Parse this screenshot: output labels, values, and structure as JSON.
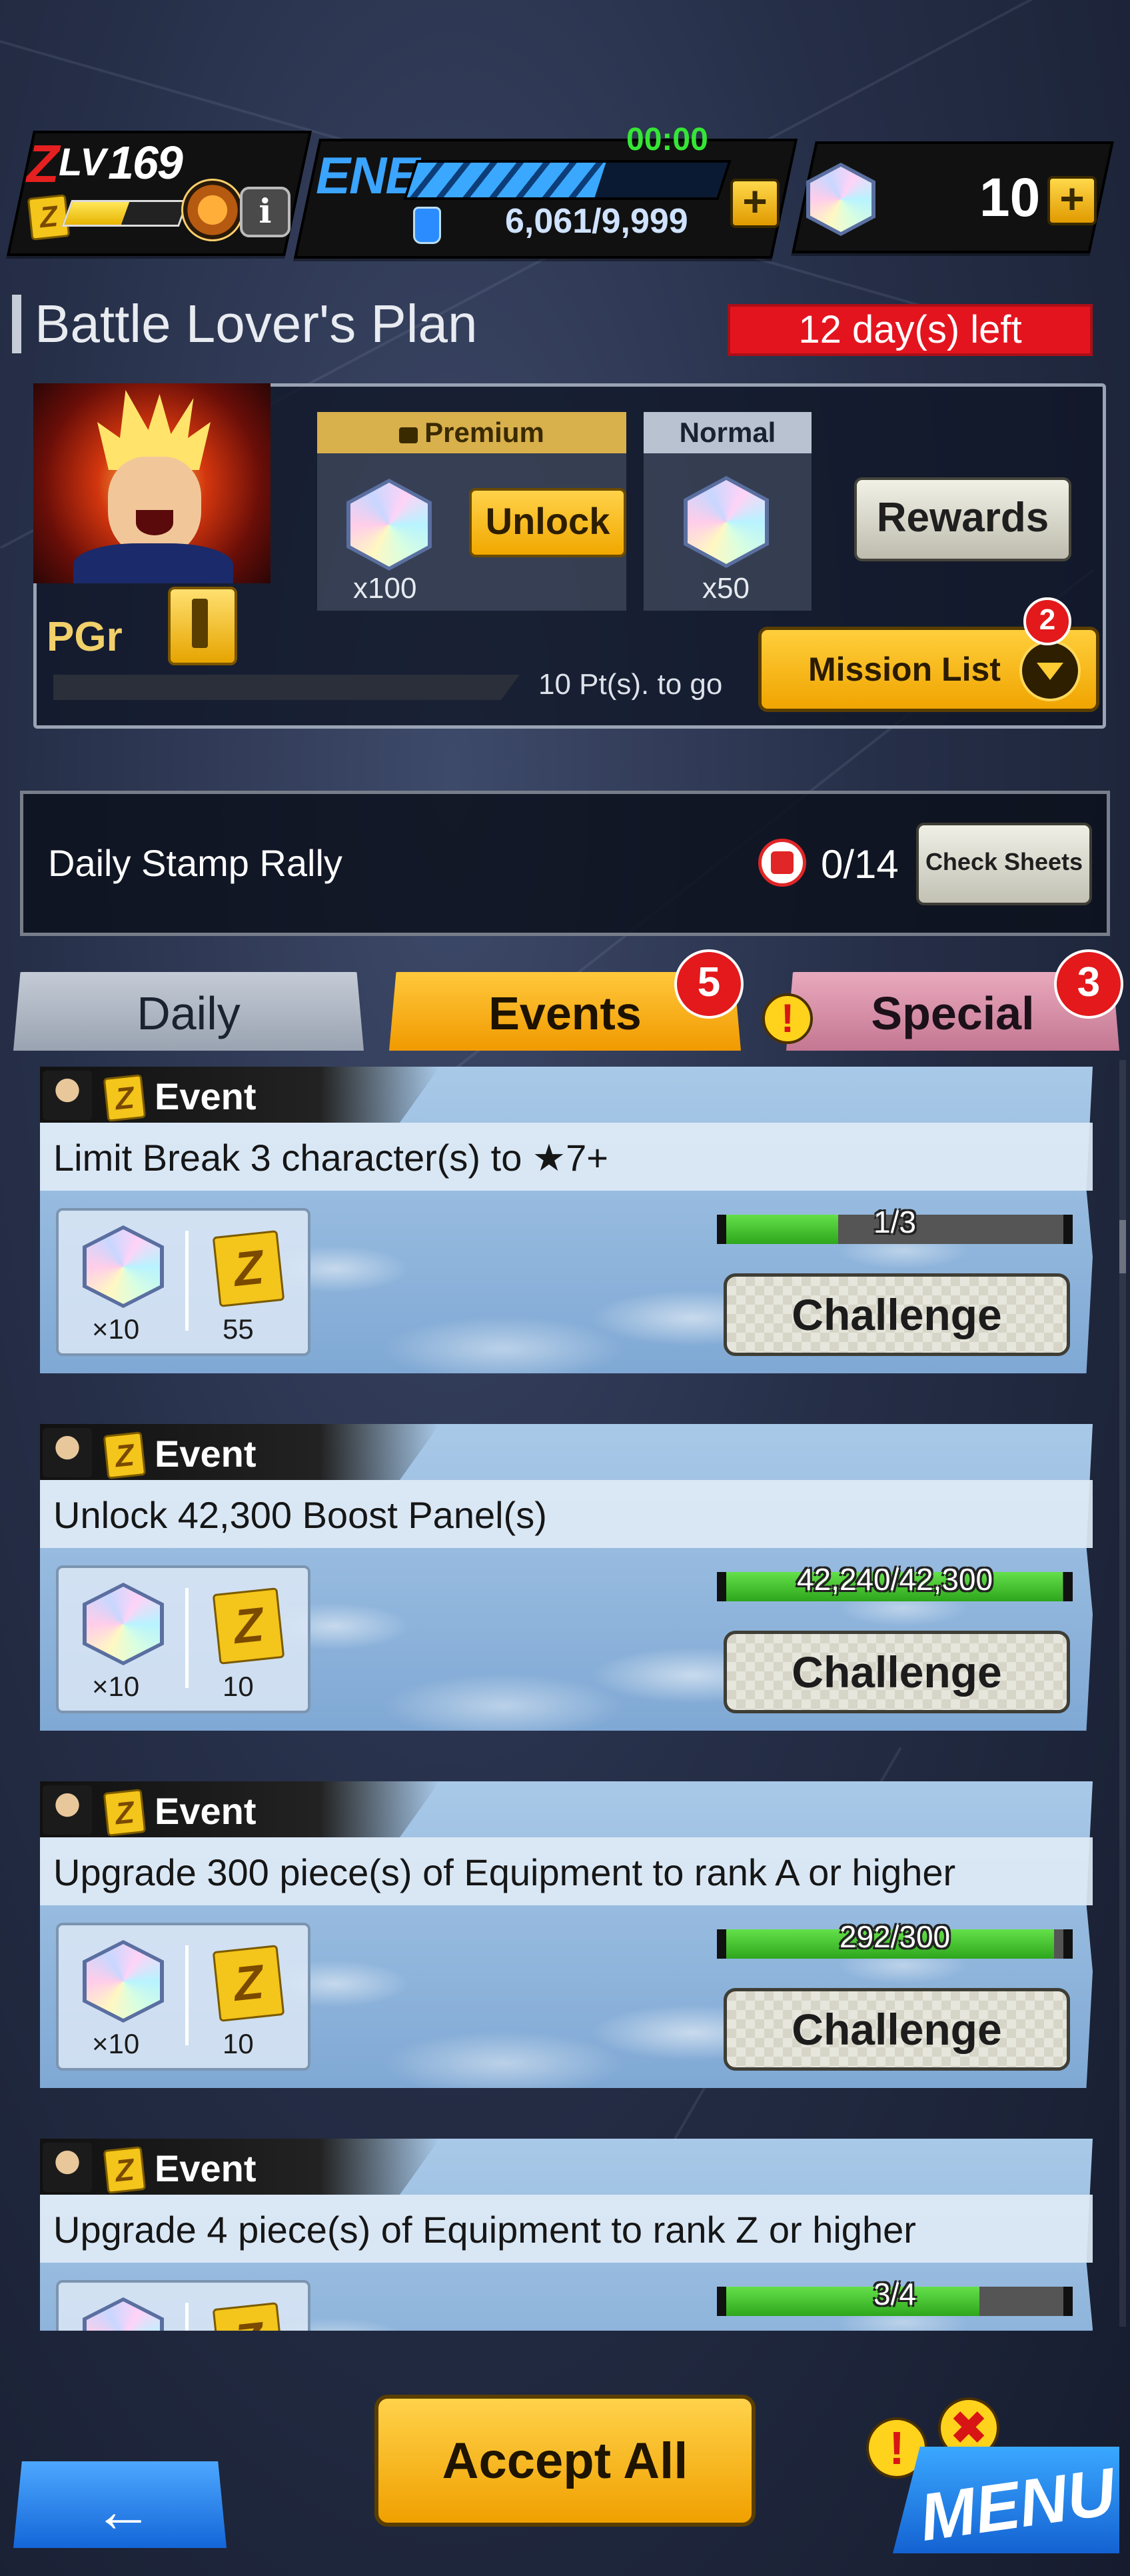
{
  "hud": {
    "level_label": "LV",
    "level": "169",
    "energy_label": "ENE",
    "energy_timer": "00:00",
    "energy_value": "6,061/9,999",
    "gem_count": "10"
  },
  "plan": {
    "title": "Battle Lover's Plan",
    "days_left": "12 day(s) left",
    "rank_label": "PGr",
    "points_to_go": "10 Pt(s). to go",
    "premium": {
      "label": "Premium",
      "quantity": "x100",
      "unlock_label": "Unlock"
    },
    "normal": {
      "label": "Normal",
      "quantity": "x50"
    },
    "rewards_label": "Rewards",
    "mission_list_label": "Mission List",
    "mission_badge": "2"
  },
  "stamp_rally": {
    "label": "Daily Stamp Rally",
    "count": "0/14",
    "check_label": "Check Sheets"
  },
  "tabs": [
    {
      "label": "Daily",
      "badge": ""
    },
    {
      "label": "Events",
      "badge": "5",
      "active": true
    },
    {
      "label": "Special",
      "badge": "3"
    }
  ],
  "missions": [
    {
      "tag": "Event",
      "title": "Limit Break 3 character(s) to ★7+",
      "gem_qty": "×10",
      "z_qty": "55",
      "progress": "1/3",
      "progress_value": 0.333,
      "button": "Challenge"
    },
    {
      "tag": "Event",
      "title": "Unlock 42,300 Boost Panel(s)",
      "gem_qty": "×10",
      "z_qty": "10",
      "progress": "42,240/42,300",
      "progress_value": 0.9986,
      "button": "Challenge"
    },
    {
      "tag": "Event",
      "title": "Upgrade 300 piece(s) of Equipment to rank A or higher",
      "gem_qty": "×10",
      "z_qty": "10",
      "progress": "292/300",
      "progress_value": 0.973,
      "button": "Challenge"
    },
    {
      "tag": "Event",
      "title": "Upgrade 4 piece(s) of Equipment to rank Z or higher",
      "gem_qty": "",
      "z_qty": "",
      "progress": "3/4",
      "progress_value": 0.75,
      "button": ""
    }
  ],
  "footer": {
    "accept_all_label": "Accept All",
    "menu_label": "MENU"
  }
}
